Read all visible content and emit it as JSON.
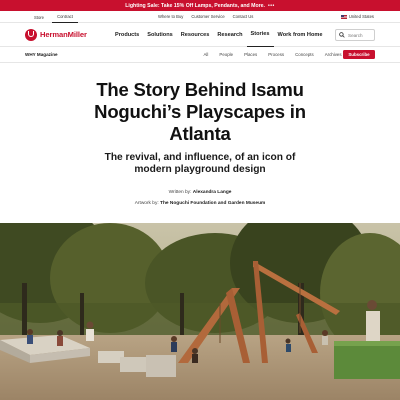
{
  "promo": {
    "text": "Lighting Sale: Take 15% Off Lamps, Pendants, and More.",
    "more": "•••"
  },
  "utility": {
    "tabs": [
      {
        "label": "Store"
      },
      {
        "label": "Contract"
      }
    ],
    "links": [
      "Where to Buy",
      "Customer Service",
      "Contact Us"
    ],
    "region": "United States"
  },
  "brand": {
    "name": "HermanMiller",
    "color": "#c8102e"
  },
  "nav": {
    "items": [
      "Products",
      "Solutions",
      "Resources",
      "Research",
      "Stories",
      "Work from Home"
    ],
    "active": "Stories"
  },
  "search": {
    "placeholder": "Search"
  },
  "subnav": {
    "label": "WHY Magazine",
    "items": [
      "All",
      "People",
      "Places",
      "Process",
      "Concepts",
      "Archives"
    ],
    "subscribe": "Subscribe"
  },
  "article": {
    "title": "The Story Behind Isamu Noguchi’s Playscapes in Atlanta",
    "subtitle": "The revival, and influence, of an icon of modern playground design",
    "byline_prefix": "Written by:",
    "author": "Alexandra Lange",
    "credit_prefix": "Artwork by:",
    "credit": "The Noguchi Foundation and Garden Museum"
  }
}
